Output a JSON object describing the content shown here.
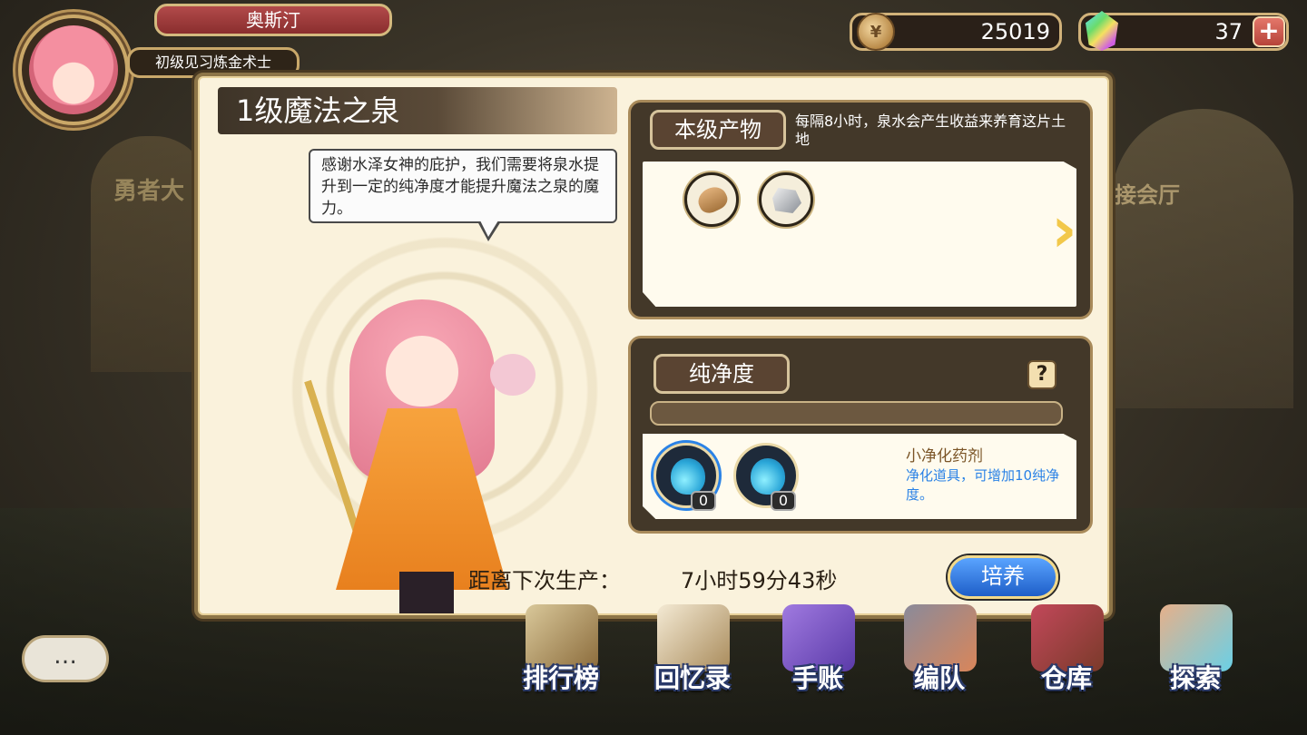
{
  "player": {
    "name": "奥斯汀",
    "title": "初级见习炼金术士"
  },
  "currency": {
    "coins": "25019",
    "gems": "37",
    "add_label": "+"
  },
  "background": {
    "left_sign": "勇者大",
    "right_sign": "接会厅"
  },
  "panel": {
    "title": "1级魔法之泉",
    "speech": "感谢水泽女神的庇护，我们需要将泉水提升到一定的纯净度才能提升魔法之泉的魔力。"
  },
  "production": {
    "tab_label": "本级产物",
    "description": "每隔8小时，泉水会产生收益来养育这片土地",
    "items": [
      "bread-icon",
      "ore-icon"
    ],
    "next_icon": "chevron-right-icon"
  },
  "purity": {
    "tab_label": "纯净度",
    "help_label": "?",
    "level": 0,
    "potions": [
      {
        "icon": "purify-potion-icon",
        "count": "0",
        "selected": true
      },
      {
        "icon": "purify-potion-large-icon",
        "count": "0",
        "selected": false
      }
    ],
    "selected_name": "小净化药剂",
    "selected_desc": "净化道具，可增加10纯净度。"
  },
  "countdown": {
    "label": "距离下次生产：",
    "value": "7小时59分43秒"
  },
  "cultivate_label": "培养",
  "chat_label": "…",
  "nav": [
    {
      "label": "排行榜",
      "icon": "leaderboard-scroll-icon"
    },
    {
      "label": "回忆录",
      "icon": "memoir-book-icon"
    },
    {
      "label": "手账",
      "icon": "notebook-icon"
    },
    {
      "label": "编队",
      "icon": "team-statue-icon"
    },
    {
      "label": "仓库",
      "icon": "warehouse-house-icon"
    },
    {
      "label": "探索",
      "icon": "explore-portal-icon"
    }
  ],
  "colors": {
    "accent_blue": "#2a82e6",
    "panel_bg": "#faf2dc",
    "frame_gold": "#c9a86a"
  }
}
